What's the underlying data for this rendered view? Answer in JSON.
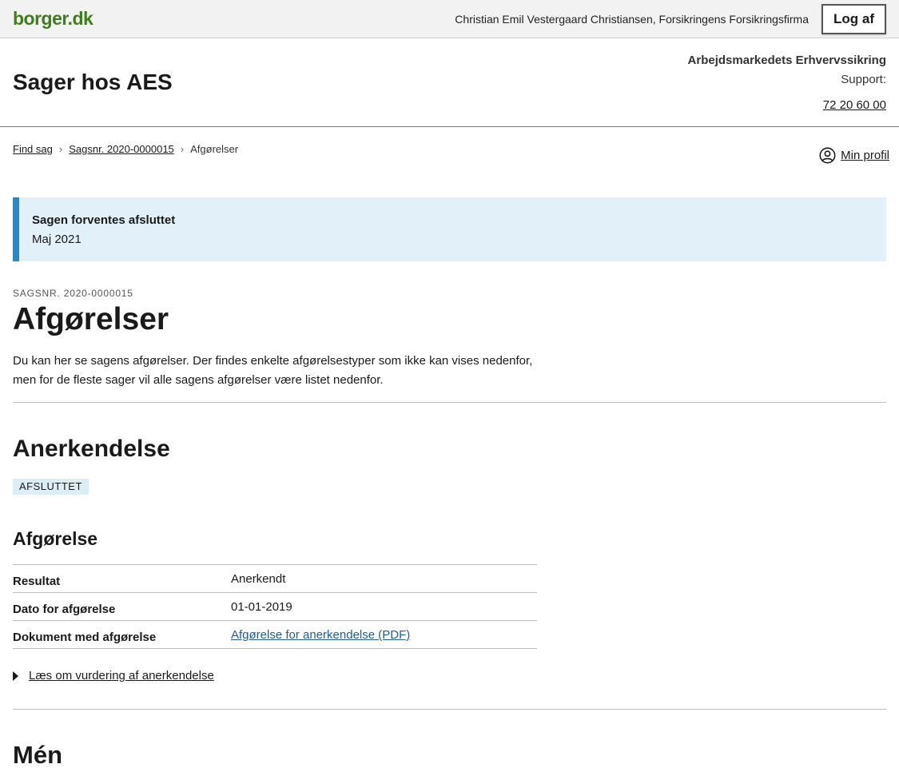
{
  "topbar": {
    "logo": "borger.dk",
    "user": "Christian Emil Vestergaard Christiansen, Forsikringens Forsikringsfirma",
    "logout_label": "Log af"
  },
  "header": {
    "title": "Sager hos AES",
    "org": "Arbejdsmarkedets Erhvervssikring",
    "support_label": "Support:",
    "support_phone": "72 20 60 00"
  },
  "breadcrumb": {
    "items": [
      "Find sag",
      "Sagsnr. 2020-0000015",
      "Afgørelser"
    ]
  },
  "profile": {
    "label": "Min profil"
  },
  "notice": {
    "title": "Sagen forventes afsluttet",
    "text": "Maj 2021"
  },
  "page": {
    "kicker": "SAGSNR. 2020-0000015",
    "title": "Afgørelser",
    "intro": "Du kan her se sagens afgørelser. Der findes enkelte afgørelsestyper som ikke kan vises nedenfor, men for de fleste sager vil alle sagens afgørelser være listet nedenfor."
  },
  "section": {
    "title": "Anerkendelse",
    "status": "AFSLUTTET",
    "subtitle": "Afgørelse",
    "rows": [
      {
        "label": "Resultat",
        "value": "Anerkendt"
      },
      {
        "label": "Dato for afgørelse",
        "value": "01-01-2019"
      },
      {
        "label": "Dokument med afgørelse",
        "value": "Afgørelse for anerkendelse (PDF)"
      }
    ],
    "expander": "Læs om vurdering af anerkendelse"
  },
  "next_section": {
    "title": "Mén"
  }
}
